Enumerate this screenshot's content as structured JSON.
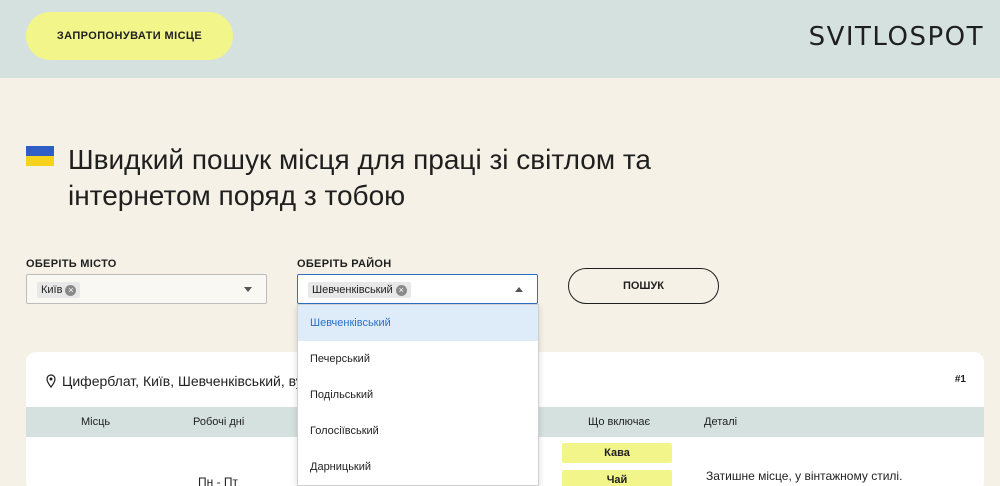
{
  "header": {
    "suggest_label": "ЗАПРОПОНУВАТИ МІСЦЕ",
    "logo": "SVITLOSPOT"
  },
  "hero": {
    "flag_icon": "ukraine-flag-icon",
    "line1": "Швидкий пошук місця для праці зі світлом та",
    "line2": "інтернетом поряд з тобою"
  },
  "filters": {
    "city_label": "ОБЕРІТЬ МІСТО",
    "city_value": "Київ",
    "district_label": "ОБЕРІТЬ РАЙОН",
    "district_value": "Шевченківський",
    "search_label": "ПОШУК"
  },
  "dropdown": {
    "options": [
      "Шевченківський",
      "Печерський",
      "Подільський",
      "Голосіївський",
      "Дарницький"
    ],
    "selected_index": 0
  },
  "result": {
    "address": "Циферблат, Київ, Шевченківський, ву",
    "number": "#1",
    "columns": [
      "Місць",
      "Робочі дні",
      "Що включає",
      "Деталі"
    ],
    "days": "Пн - Пт",
    "includes": [
      "Кава",
      "Чай"
    ],
    "details": "Затишне місце, у вінтажному стилі."
  },
  "colors": {
    "accent_yellow": "#f2f58a",
    "header_bg": "#d5e1df",
    "page_bg": "#f5f1e6",
    "focus_blue": "#2a72c8"
  }
}
